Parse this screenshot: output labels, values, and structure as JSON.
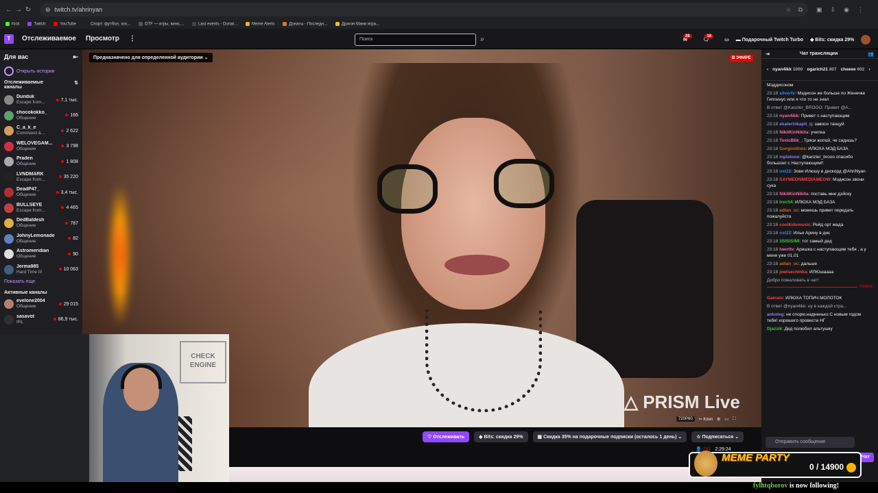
{
  "browser": {
    "url": "twitch.tv/ahrinyan",
    "bookmarks": [
      {
        "label": "Kick",
        "color": "#53fc18"
      },
      {
        "label": "Twitch",
        "color": "#9147ff"
      },
      {
        "label": "YouTube",
        "color": "#ff0000"
      },
      {
        "label": "Спорт: футбол, хок...",
        "color": "#222222"
      },
      {
        "label": "DTF — игры, кино,...",
        "color": "#555555"
      },
      {
        "label": "Last events - Donat...",
        "color": "#444444"
      },
      {
        "label": "Meme Alerts",
        "color": "#f0b030"
      },
      {
        "label": "Донаты - Последн...",
        "color": "#f07020"
      },
      {
        "label": "Драгон Мани игра...",
        "color": "#f0c020"
      }
    ]
  },
  "topnav": {
    "logo": "T",
    "following": "Отслеживаемое",
    "browse": "Просмотр",
    "more": "⋮",
    "search_placeholder": "Поиск",
    "notif_count_1": "28",
    "notif_count_2": "16",
    "turbo": "Подарочный Twitch Turbo",
    "bits": "Bits: скидка 29%"
  },
  "sidebar": {
    "title": "Для вас",
    "stories": "Открыть истории",
    "followed_title": "Отслеживаемые каналы",
    "channels": [
      {
        "name": "Dunduk",
        "game": "Escape from...",
        "viewers": "7,1 тыс.",
        "color": "#888888"
      },
      {
        "name": "chocokokko_",
        "game": "Общение",
        "viewers": "166",
        "color": "#5f9e6e"
      },
      {
        "name": "C_a_k_e",
        "game": "Command &...",
        "viewers": "2 622",
        "color": "#d0a060"
      },
      {
        "name": "WELOVEGAM...",
        "game": "Общение",
        "viewers": "3 798",
        "color": "#d03040"
      },
      {
        "name": "Praden",
        "game": "Общение",
        "viewers": "1 808",
        "color": "#aaaaaa"
      },
      {
        "name": "LVNDMARK",
        "game": "Escape from...",
        "viewers": "35 220",
        "color": "#222222"
      },
      {
        "name": "DeadP47_",
        "game": "Общение",
        "viewers": "3,4 тыс.",
        "color": "#b03030"
      },
      {
        "name": "BULLSEYE",
        "game": "Escape from...",
        "viewers": "4 465",
        "color": "#c04040"
      },
      {
        "name": "DedBaldesh",
        "game": "Общение",
        "viewers": "787",
        "color": "#e0b040"
      },
      {
        "name": "JohnyLemonade",
        "game": "Общение",
        "viewers": "82",
        "color": "#6080c0"
      },
      {
        "name": "Astromeridian",
        "game": "Общение",
        "viewers": "90",
        "color": "#dddddd"
      },
      {
        "name": "Jerma985",
        "game": "Hard Time III",
        "viewers": "10 063",
        "color": "#406080"
      }
    ],
    "show_more": "Показать еще",
    "active_title": "Активные каналы",
    "active": [
      {
        "name": "evelone2004",
        "game": "Общение",
        "viewers": "29 015",
        "color": "#b08070"
      },
      {
        "name": "sasavot",
        "game": "IRL",
        "viewers": "86,9 тыс.",
        "color": "#303030"
      }
    ]
  },
  "video": {
    "audience_label": "Предназначено для определенной аудитории",
    "live_tag": "В ЭФИРЕ",
    "watermark": "PRISM Live",
    "quality": "720P60",
    "clip": "Клип"
  },
  "webcam": {
    "sign": "CHECK ENGINE"
  },
  "actions": {
    "follow": "Отслеживать",
    "bits": "Bits: скидка 29%",
    "gift_sale": "Скидка 35% на подарочные подписки (осталось 1 день)",
    "subscribe": "Подписаться",
    "viewers": "781",
    "uptime": "2:29:24"
  },
  "chat": {
    "title": "Чат трансляции",
    "top_gifters": [
      {
        "name": "nyan4ikk",
        "amount": "1000"
      },
      {
        "name": "ogarich21",
        "amount": "807"
      },
      {
        "name": "cheeee",
        "amount": "602"
      }
    ],
    "messages": [
      {
        "ts": "",
        "user": "",
        "color": "#efeff1",
        "text": "Мэддисоном"
      },
      {
        "ts": "23:18",
        "user": "silvertv",
        "color": "#1e90ff",
        "text": ": Мэдисон же больше по Женечке Гиппинус или я что то не знал"
      },
      {
        "ts": "",
        "user": "",
        "color": "#adadb8",
        "text": "В ответ @Kanzler_BROOO: Привет @А..."
      },
      {
        "ts": "23:18",
        "user": "nyan4ikk",
        "color": "#ff69b4",
        "text": ": Привет с наступающим"
      },
      {
        "ts": "23:18",
        "user": "ekaterinkapit_q",
        "color": "#8a7cff",
        "text": ": завоси танцуй"
      },
      {
        "ts": "23:18",
        "user": "NikitKinNikita",
        "color": "#ff6fa0",
        "text": ": училка"
      },
      {
        "ts": "23:18",
        "user": "ToxicBlik_",
        "color": "#ff69b4",
        "text": ": Тряси жопой, че сидишь?"
      },
      {
        "ts": "23:18",
        "user": "Gorgonlines",
        "color": "#d2691e",
        "text": ": ИЛЮХА МЭД БАЗА"
      },
      {
        "ts": "23:18",
        "user": "mplatooo",
        "color": "#8a7cff",
        "text": ": @kanzler_brooo спасибо большое! с Наступающим!!"
      },
      {
        "ts": "23:18",
        "user": "ost22",
        "color": "#1e90ff",
        "text": ": Зови Илюшу в дискорд @AhriNyan"
      },
      {
        "ts": "23:18",
        "user": "SAYMEONMEDIAMEOW",
        "color": "#ff4040",
        "text": ": Мэдисон звони сука"
      },
      {
        "ts": "23:18",
        "user": "NikitKinNikita",
        "color": "#ff6fa0",
        "text": ": поставь мне дэйску"
      },
      {
        "ts": "23:18",
        "user": "trec54",
        "color": "#32cd32",
        "text": ": ИЛЮХА МЭД БАЗА"
      },
      {
        "ts": "23:18",
        "user": "adlan_vc",
        "color": "#d2691e",
        "text": ": можешь привет передать пожалуйста"
      },
      {
        "ts": "23:18",
        "user": "coolkidsmusic",
        "color": "#ff4040",
        "text": ": Рейд орт мада"
      },
      {
        "ts": "23:18",
        "user": "ost22",
        "color": "#1e90ff",
        "text": ": Илья Арину в дис"
      },
      {
        "ts": "23:18",
        "user": "3SISISIMI",
        "color": "#32cd32",
        "text": ": тот самый дед"
      },
      {
        "ts": "23:18",
        "user": "lwerttv",
        "color": "#ff6fa0",
        "text": ": Аришка с наступающим тебя , а у меня уже 01.01"
      },
      {
        "ts": "23:18",
        "user": "adlan_vc",
        "color": "#d2691e",
        "text": ": дальше"
      },
      {
        "ts": "23:18",
        "user": "jewisechinka",
        "color": "#ff4040",
        "text": ": ИЛЮшаааа"
      },
      {
        "ts": "",
        "user": "",
        "color": "#adadb8",
        "text": "Добро пожаловать в чат!"
      }
    ],
    "new_label": "Новое",
    "new_messages": [
      {
        "ts": "",
        "user": "Gamalx",
        "color": "#ff4040",
        "text": ": ИЛЮХА ТОПИЧ МОЛОТОК"
      },
      {
        "ts": "",
        "user": "",
        "color": "#adadb8",
        "text": "В ответ @nyan4ikk: ну в каждой стра..."
      },
      {
        "ts": "",
        "user": "ankoleg",
        "color": "#8a7cff",
        "text": ": не спорю,надненько С новым годом тебя! хорошего провести НГ"
      },
      {
        "ts": "",
        "user": "Djazzik",
        "color": "#32cd32",
        "text": ": Дед полюбил альтушку"
      }
    ],
    "input_placeholder": "Отправить сообщение",
    "send": "Чат"
  },
  "overlay": {
    "meme_title": "MEME PARTY",
    "meme_count": "0 / 14900",
    "follow_user": "fylhtqborov",
    "follow_text": " is now following!"
  }
}
